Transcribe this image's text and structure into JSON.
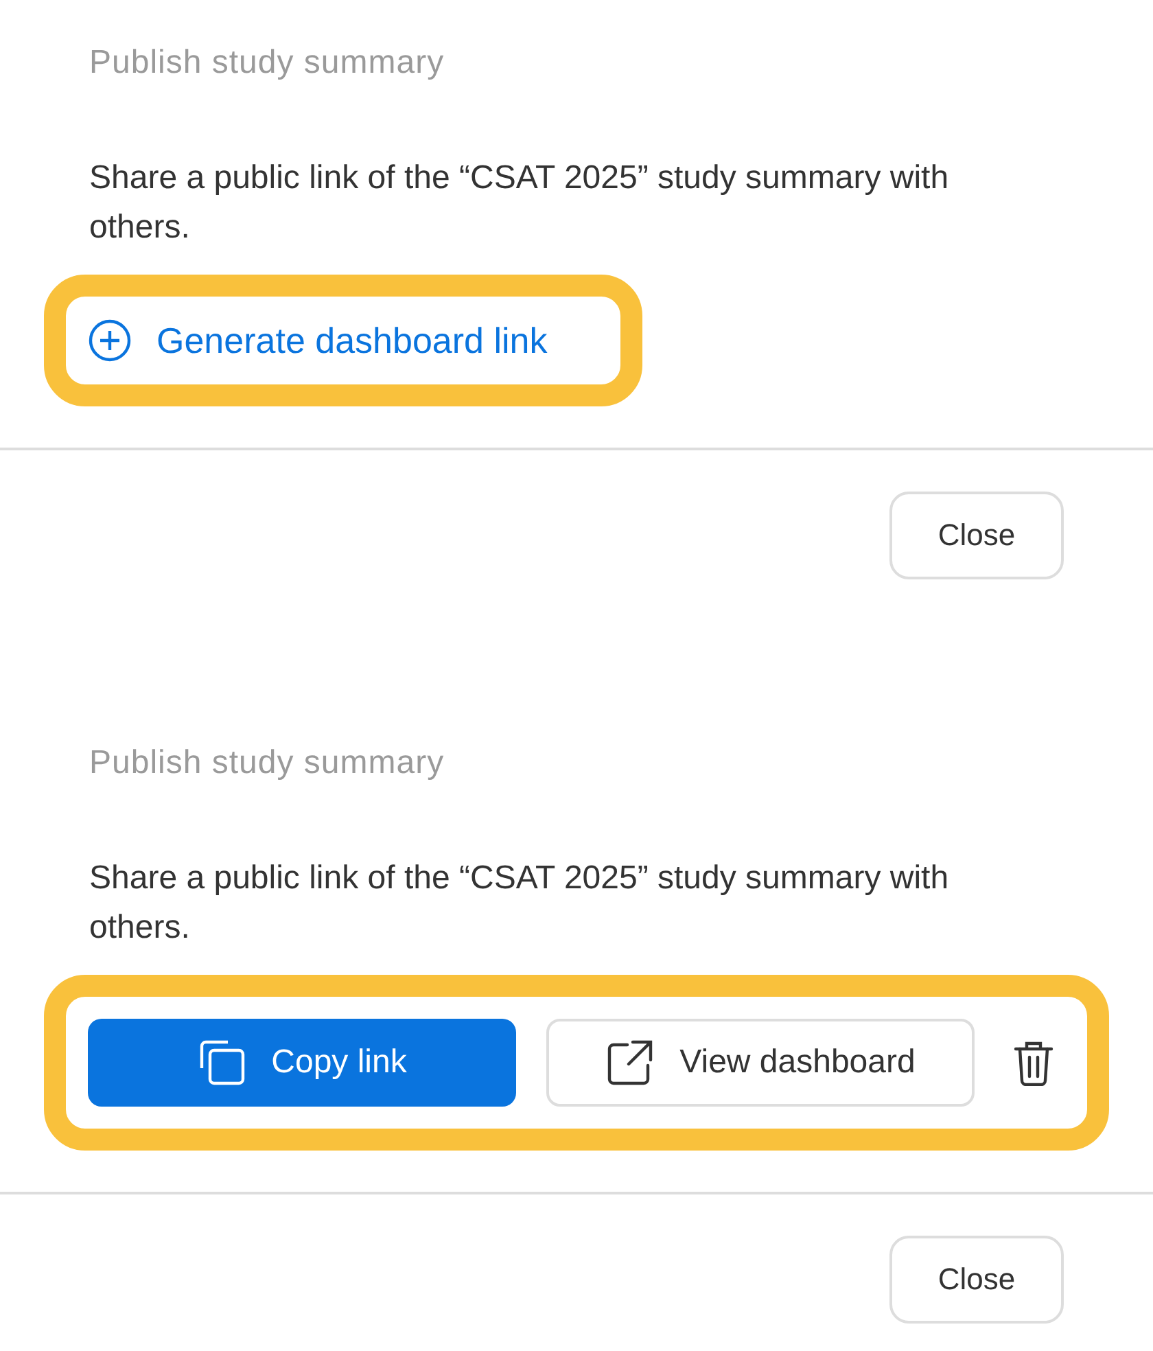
{
  "panels": [
    {
      "kind": "empty",
      "title": "Publish study summary",
      "description": "Share a public link of the “CSAT 2025” study summary with others.",
      "highlighted": true,
      "generate_label": "Generate dashboard link",
      "close_label": "Close"
    },
    {
      "kind": "published",
      "title": "Publish study summary",
      "description": "Share a public link of the “CSAT 2025” study summary with others.",
      "highlighted": true,
      "copy_label": "Copy link",
      "view_label": "View dashboard",
      "close_label": "Close"
    }
  ]
}
